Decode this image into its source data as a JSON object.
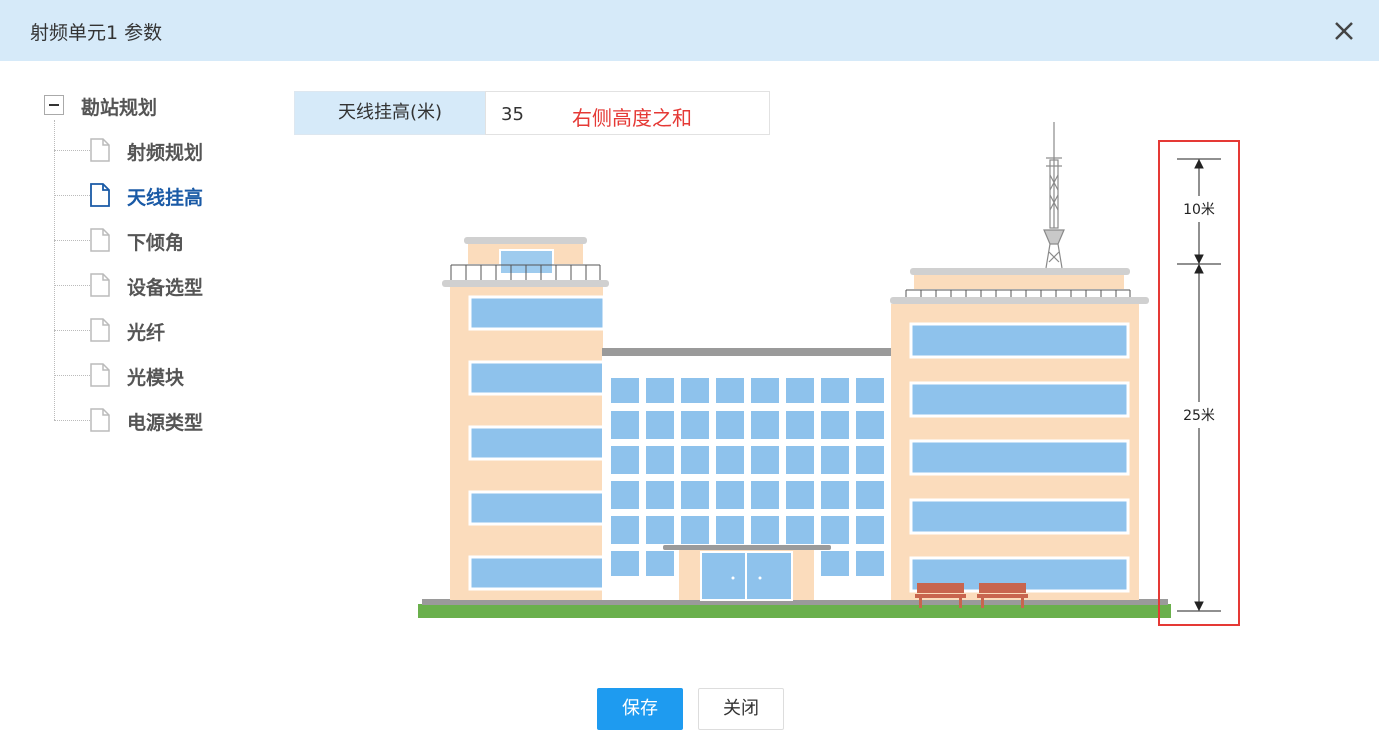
{
  "dialog": {
    "title": "射频单元1 参数"
  },
  "tree": {
    "root_label": "勘站规划",
    "items": [
      {
        "label": "射频规划",
        "active": false
      },
      {
        "label": "天线挂高",
        "active": true
      },
      {
        "label": "下倾角",
        "active": false
      },
      {
        "label": "设备选型",
        "active": false
      },
      {
        "label": "光纤",
        "active": false
      },
      {
        "label": "光模块",
        "active": false
      },
      {
        "label": "电源类型",
        "active": false
      }
    ]
  },
  "form": {
    "label": "天线挂高(米)",
    "value": "35",
    "note": "右侧高度之和"
  },
  "illustration": {
    "dimension_top": "10米",
    "dimension_bottom": "25米"
  },
  "buttons": {
    "save": "保存",
    "close": "关闭"
  },
  "colors": {
    "title_bar": "#d6eaf9",
    "active_item": "#1a5aa6",
    "note_red": "#e53935",
    "primary_button": "#1e9bf0",
    "highlight_box": "#e53935"
  }
}
